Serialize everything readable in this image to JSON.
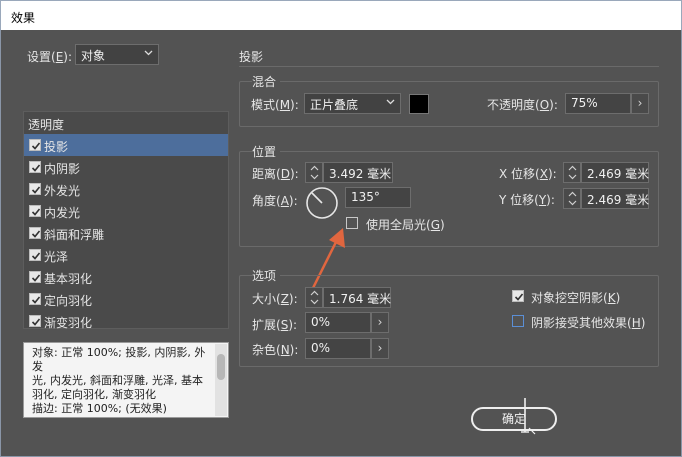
{
  "window": {
    "title": "效果"
  },
  "settings": {
    "label": "设置(",
    "key": "E",
    "suffix": "):",
    "value": "对象"
  },
  "section_title": "投影",
  "effects_list": {
    "items": [
      {
        "label": "透明度",
        "checked": null,
        "selected": false
      },
      {
        "label": "投影",
        "checked": true,
        "selected": true
      },
      {
        "label": "内阴影",
        "checked": true,
        "selected": false
      },
      {
        "label": "外发光",
        "checked": true,
        "selected": false
      },
      {
        "label": "内发光",
        "checked": true,
        "selected": false
      },
      {
        "label": "斜面和浮雕",
        "checked": true,
        "selected": false
      },
      {
        "label": "光泽",
        "checked": true,
        "selected": false
      },
      {
        "label": "基本羽化",
        "checked": true,
        "selected": false
      },
      {
        "label": "定向羽化",
        "checked": true,
        "selected": false
      },
      {
        "label": "渐变羽化",
        "checked": true,
        "selected": false
      }
    ]
  },
  "description": {
    "line1": "对象: 正常 100%; 投影, 内阴影, 外发",
    "line2": "光, 内发光, 斜面和浮雕, 光泽, 基本",
    "line3": "羽化, 定向羽化, 渐变羽化",
    "line4": "描边: 正常 100%; (无效果)"
  },
  "blend": {
    "title": "混合",
    "mode_label": "模式(",
    "mode_key": "M",
    "mode_suffix": "):",
    "mode_value": "正片叠底",
    "color": "#000000",
    "opacity_label": "不透明度(",
    "opacity_key": "O",
    "opacity_suffix": "):",
    "opacity_value": "75%"
  },
  "position": {
    "title": "位置",
    "distance_label": "距离(",
    "distance_key": "D",
    "distance_suffix": "):",
    "distance_value": "3.492 毫米",
    "angle_label": "角度(",
    "angle_key": "A",
    "angle_suffix": "):",
    "angle_value": "135°",
    "global_light_label": "使用全局光(",
    "global_light_key": "G",
    "global_light_suffix": ")",
    "global_light_checked": false,
    "x_offset_label": "X 位移(",
    "x_offset_key": "X",
    "x_offset_suffix": "):",
    "x_offset_value": "2.469 毫米",
    "y_offset_label": "Y 位移(",
    "y_offset_key": "Y",
    "y_offset_suffix": "):",
    "y_offset_value": "2.469 毫米"
  },
  "options": {
    "title": "选项",
    "size_label": "大小(",
    "size_key": "Z",
    "size_suffix": "):",
    "size_value": "1.764 毫米",
    "spread_label": "扩展(",
    "spread_key": "S",
    "spread_suffix": "):",
    "spread_value": "0%",
    "noise_label": "杂色(",
    "noise_key": "N",
    "noise_suffix": "):",
    "noise_value": "0%",
    "knockout_label": "对象挖空阴影(",
    "knockout_key": "K",
    "knockout_suffix": ")",
    "knockout_checked": true,
    "honor_label": "阴影接受其他效果(",
    "honor_key": "H",
    "honor_suffix": ")",
    "honor_checked": false
  },
  "buttons": {
    "ok": "确定"
  },
  "colors": {
    "accent": "#4d6e9c",
    "annotation_arrow": "#e0663f"
  }
}
